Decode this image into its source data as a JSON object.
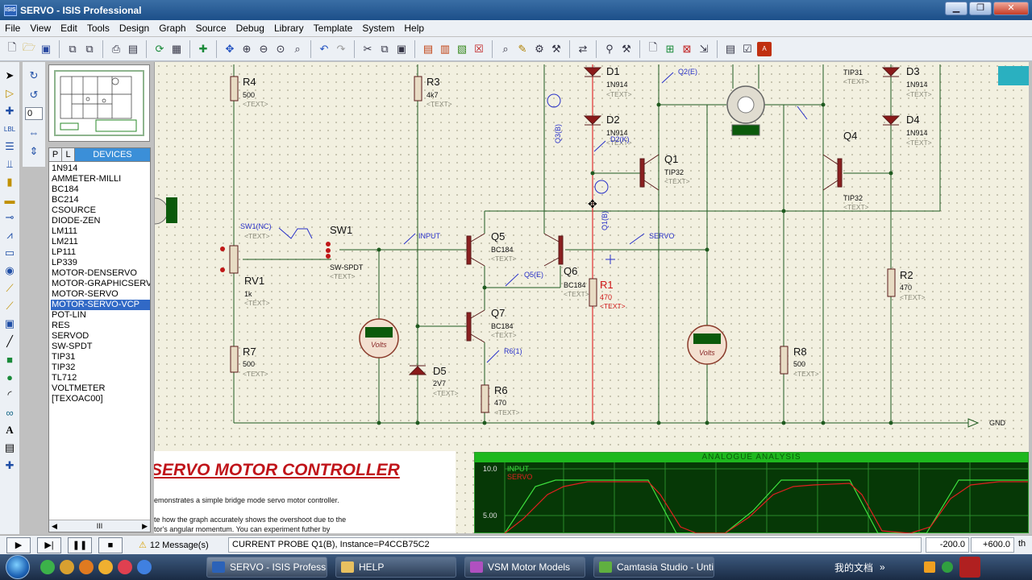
{
  "window": {
    "title": "SERVO - ISIS Professional",
    "app_icon": "ISIS"
  },
  "menu": [
    "File",
    "View",
    "Edit",
    "Tools",
    "Design",
    "Graph",
    "Source",
    "Debug",
    "Library",
    "Template",
    "System",
    "Help"
  ],
  "rotation": "0",
  "devices": {
    "tab_p": "P",
    "tab_l": "L",
    "title": "DEVICES",
    "items": [
      "1N914",
      "AMMETER-MILLI",
      "BC184",
      "BC214",
      "CSOURCE",
      "DIODE-ZEN",
      "LM111",
      "LM211",
      "LP111",
      "LP339",
      "MOTOR-DENSERVO",
      "MOTOR-GRAPHICSERVO",
      "MOTOR-SERVO",
      "MOTOR-SERVO-VCP",
      "POT-LIN",
      "RES",
      "SERVOD",
      "SW-SPDT",
      "TIP31",
      "TIP32",
      "TL712",
      "VOLTMETER",
      "[TEXOAC00]"
    ],
    "selected": "MOTOR-SERVO-VCP",
    "scroll_grip": "III"
  },
  "schematic": {
    "components": [
      {
        "ref": "R4",
        "value": "500",
        "text": "<TEXT>"
      },
      {
        "ref": "R3",
        "value": "4k7",
        "text": "<TEXT>"
      },
      {
        "ref": "D1",
        "value": "1N914",
        "text": "<TEXT>"
      },
      {
        "ref": "D2",
        "value": "1N914",
        "text": "<TEXT>"
      },
      {
        "ref": "D3",
        "value": "1N914",
        "text": "<TEXT>"
      },
      {
        "ref": "D4",
        "value": "1N914",
        "text": "<TEXT>"
      },
      {
        "ref": "Q1",
        "value": "TIP32",
        "text": "<TEXT>"
      },
      {
        "ref": "Q4",
        "value": "TIP32",
        "text": "<TEXT>"
      },
      {
        "ref": "TIP31",
        "value": "",
        "text": "<TEXT>"
      },
      {
        "ref": "Q5",
        "value": "BC184",
        "text": "<TEXT>"
      },
      {
        "ref": "Q6",
        "value": "BC184",
        "text": "<TEXT>"
      },
      {
        "ref": "Q7",
        "value": "BC184",
        "text": "<TEXT>"
      },
      {
        "ref": "SW1",
        "value": "SW-SPDT",
        "text": "<TEXT>"
      },
      {
        "ref": "RV1",
        "value": "1k",
        "text": "<TEXT>"
      },
      {
        "ref": "R1",
        "value": "470",
        "text": "<TEXT>"
      },
      {
        "ref": "R2",
        "value": "470",
        "text": "<TEXT>"
      },
      {
        "ref": "R6",
        "value": "470",
        "text": "<TEXT>"
      },
      {
        "ref": "R7",
        "value": "500",
        "text": "<TEXT>"
      },
      {
        "ref": "R8",
        "value": "500",
        "text": "<TEXT>"
      },
      {
        "ref": "D5",
        "value": "2V7",
        "text": "<TEXT>"
      }
    ],
    "probes": [
      "Q2(E)",
      "Q3(B)",
      "D2(K)",
      "Q1(B)",
      "INPUT",
      "SERVO",
      "Q5(E)",
      "R6(1)",
      "SW1(NC)"
    ],
    "voltmeter_label": "Volts",
    "ground_label": "GND"
  },
  "document": {
    "title": "SERVO MOTOR CONTROLLER",
    "line1": "emonstrates a simple bridge mode servo motor controller.",
    "line2": "te how the graph accurately shows the overshoot due to the",
    "line3": "tor's angular momentum. You can experiment futher by"
  },
  "graph": {
    "title": "ANALOGUE ANALYSIS",
    "traces": [
      {
        "name": "INPUT",
        "color": "#3ee03e"
      },
      {
        "name": "SERVO",
        "color": "#e02020"
      }
    ],
    "y_ticks": [
      "10.0",
      "5.00"
    ]
  },
  "status": {
    "messages": "12 Message(s)",
    "probe": "CURRENT PROBE Q1(B), Instance=P4CCB75C2",
    "x": "-200.0",
    "y": "+600.0",
    "unit": "th"
  },
  "taskbar": {
    "tasks": [
      {
        "label": "SERVO - ISIS Professi...",
        "active": true
      },
      {
        "label": "HELP",
        "active": false
      },
      {
        "label": "VSM Motor Models",
        "active": false
      },
      {
        "label": "Camtasia Studio - Unti...",
        "active": false
      }
    ],
    "tray_text": "我的文档",
    "tray_chevron": "»"
  }
}
